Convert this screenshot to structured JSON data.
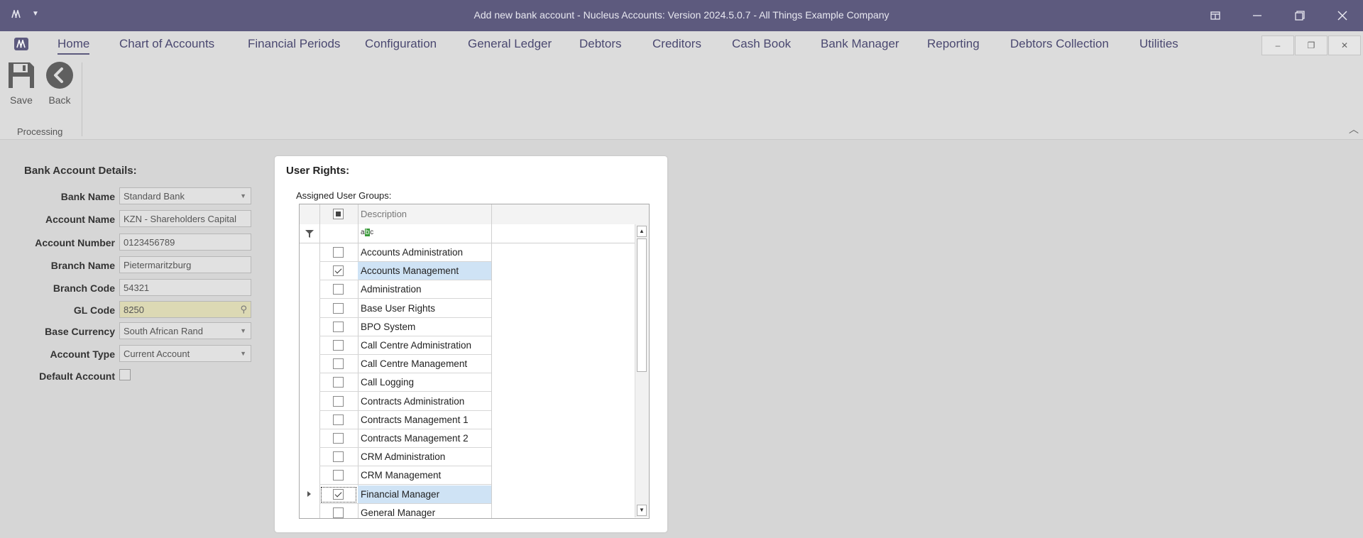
{
  "window": {
    "title": "Add new bank account - Nucleus Accounts: Version 2024.5.0.7 - All Things Example Company"
  },
  "menu": {
    "tabs": [
      "Home",
      "Chart of Accounts",
      "Financial Periods",
      "Configuration",
      "General Ledger",
      "Debtors",
      "Creditors",
      "Cash Book",
      "Bank Manager",
      "Reporting",
      "Debtors Collection",
      "Utilities"
    ],
    "active": "Home"
  },
  "ribbon": {
    "save_label": "Save",
    "back_label": "Back",
    "group_label": "Processing"
  },
  "form": {
    "title": "Bank Account Details:",
    "bank_name_label": "Bank Name",
    "bank_name": "Standard Bank",
    "account_name_label": "Account Name",
    "account_name": "KZN - Shareholders Capital",
    "account_number_label": "Account Number",
    "account_number": "0123456789",
    "branch_name_label": "Branch Name",
    "branch_name": "Pietermaritzburg",
    "branch_code_label": "Branch Code",
    "branch_code": "54321",
    "gl_code_label": "GL Code",
    "gl_code": "8250",
    "base_currency_label": "Base Currency",
    "base_currency": "South African Rand",
    "account_type_label": "Account Type",
    "account_type": "Current Account",
    "default_account_label": "Default Account",
    "default_account": false
  },
  "user_rights": {
    "title": "User Rights:",
    "assigned_label": "Assigned User Groups:",
    "column_header": "Description",
    "filter_icon": "filter-icon",
    "text_filter_icon": "abc-filter-icon",
    "groups": [
      {
        "name": "Accounts Administration",
        "checked": false
      },
      {
        "name": "Accounts Management",
        "checked": true
      },
      {
        "name": "Administration",
        "checked": false
      },
      {
        "name": "Base User Rights",
        "checked": false
      },
      {
        "name": "BPO System",
        "checked": false
      },
      {
        "name": "Call Centre Administration",
        "checked": false
      },
      {
        "name": "Call Centre Management",
        "checked": false
      },
      {
        "name": "Call Logging",
        "checked": false
      },
      {
        "name": "Contracts Administration",
        "checked": false
      },
      {
        "name": "Contracts Management 1",
        "checked": false
      },
      {
        "name": "Contracts Management 2",
        "checked": false
      },
      {
        "name": "CRM Administration",
        "checked": false
      },
      {
        "name": "CRM Management",
        "checked": false
      },
      {
        "name": "Financial Manager",
        "checked": true
      },
      {
        "name": "General Manager",
        "checked": false
      }
    ]
  },
  "colors": {
    "titlebar": "#5d5a7e",
    "selected_row": "#cfe3f5",
    "gl_field": "#dcd9b4"
  }
}
